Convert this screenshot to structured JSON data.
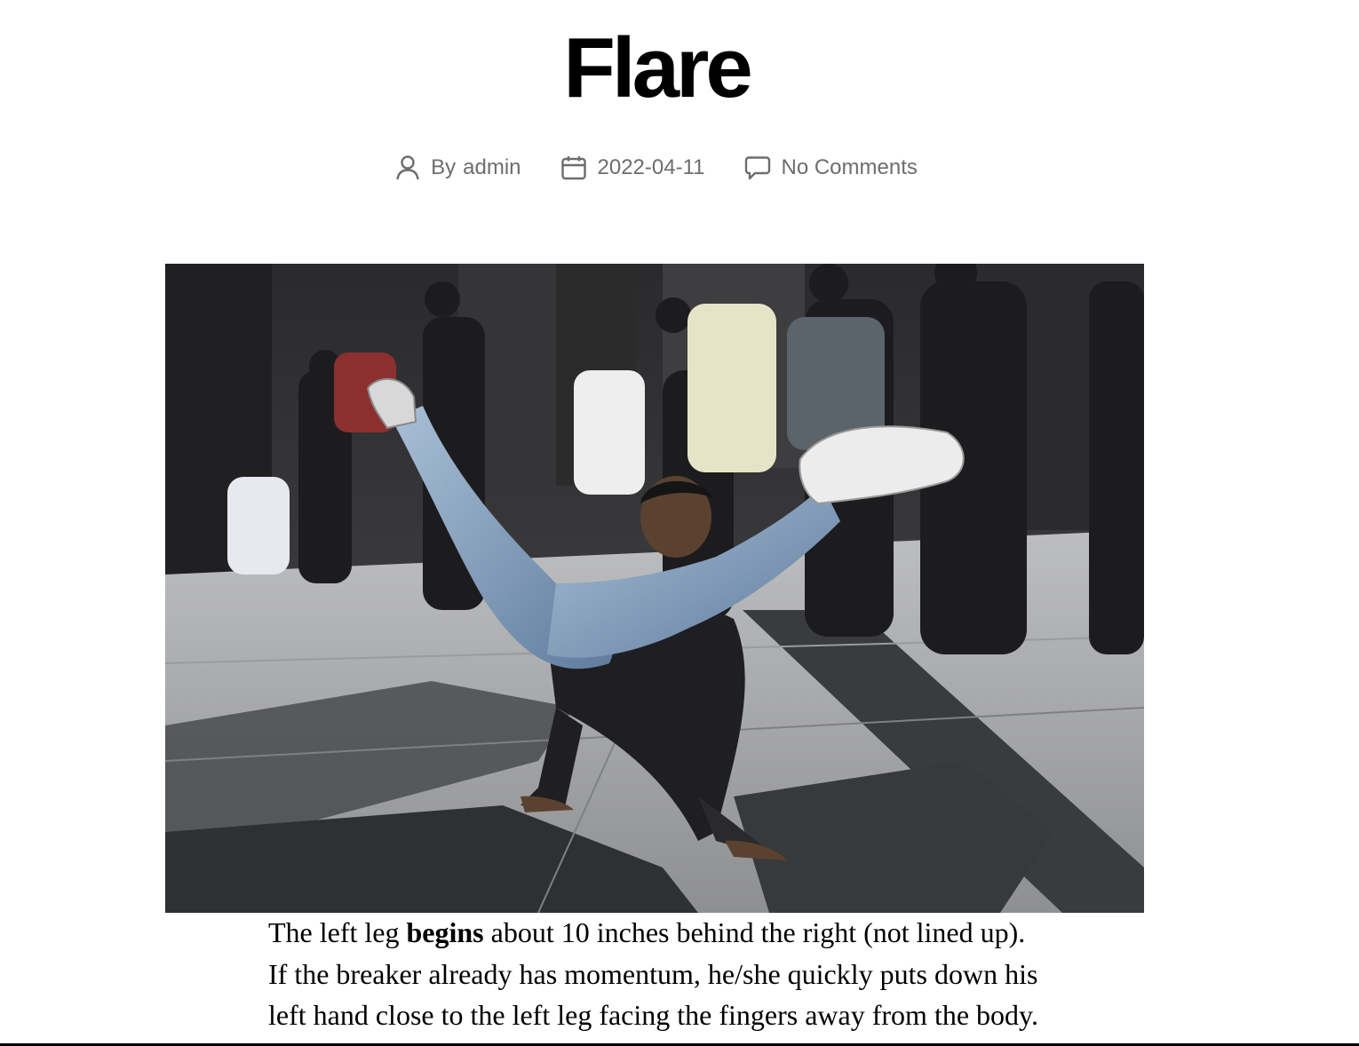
{
  "post": {
    "title": "Flare",
    "meta": {
      "author_prefix": "By",
      "author": "admin",
      "date": "2022-04-11",
      "comments": "No Comments"
    },
    "content": {
      "text_before": "The left leg ",
      "bold": "begins",
      "text_after": " about 10 inches behind the right (not lined up). If the breaker already has momentum, he/she quickly puts down his left hand close to the left leg facing the fingers away from the body. Then, quickly the left leg swings in a half-circle motion to the right"
    }
  },
  "icons": {
    "author": "person-icon",
    "date": "calendar-icon",
    "comments": "comment-bubble-icon"
  },
  "colors": {
    "meta_text": "#6d6d6d",
    "title": "#000000"
  }
}
